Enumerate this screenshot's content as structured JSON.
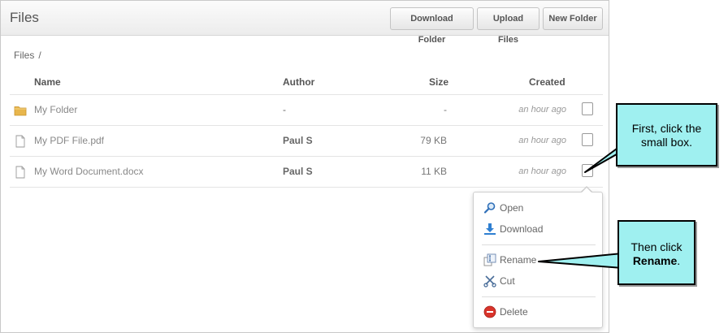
{
  "header": {
    "title": "Files",
    "buttons": [
      "Download Folder",
      "Upload Files",
      "New Folder"
    ]
  },
  "breadcrumb": {
    "root": "Files",
    "separator": "/"
  },
  "table": {
    "columns": {
      "name": "Name",
      "author": "Author",
      "size": "Size",
      "created": "Created"
    },
    "rows": [
      {
        "name": "My Folder",
        "author": "-",
        "size": "-",
        "created": "an hour ago",
        "type": "folder-icon"
      },
      {
        "name": "My PDF File.pdf",
        "author": "Paul S",
        "size": "79 KB",
        "created": "an hour ago",
        "type": "file-icon"
      },
      {
        "name": "My Word Document.docx",
        "author": "Paul S",
        "size": "11 KB",
        "created": "an hour ago",
        "type": "file-icon"
      }
    ]
  },
  "context_menu": {
    "items": [
      {
        "label": "Open",
        "icon": "magnifier-icon"
      },
      {
        "label": "Download",
        "icon": "download-arrow-icon"
      },
      {
        "label": "Rename",
        "icon": "rename-icon"
      },
      {
        "label": "Cut",
        "icon": "scissors-icon"
      },
      {
        "label": "Delete",
        "icon": "delete-circle-icon"
      }
    ]
  },
  "callouts": {
    "first": "First, click the small box.",
    "second_prefix": "Then click",
    "second_bold": "Rename",
    "second_suffix": "."
  },
  "colors": {
    "callout": "#9ff0f0",
    "folder": "#e8b64c",
    "delete": "#d9342b",
    "download": "#2f7fd1"
  }
}
